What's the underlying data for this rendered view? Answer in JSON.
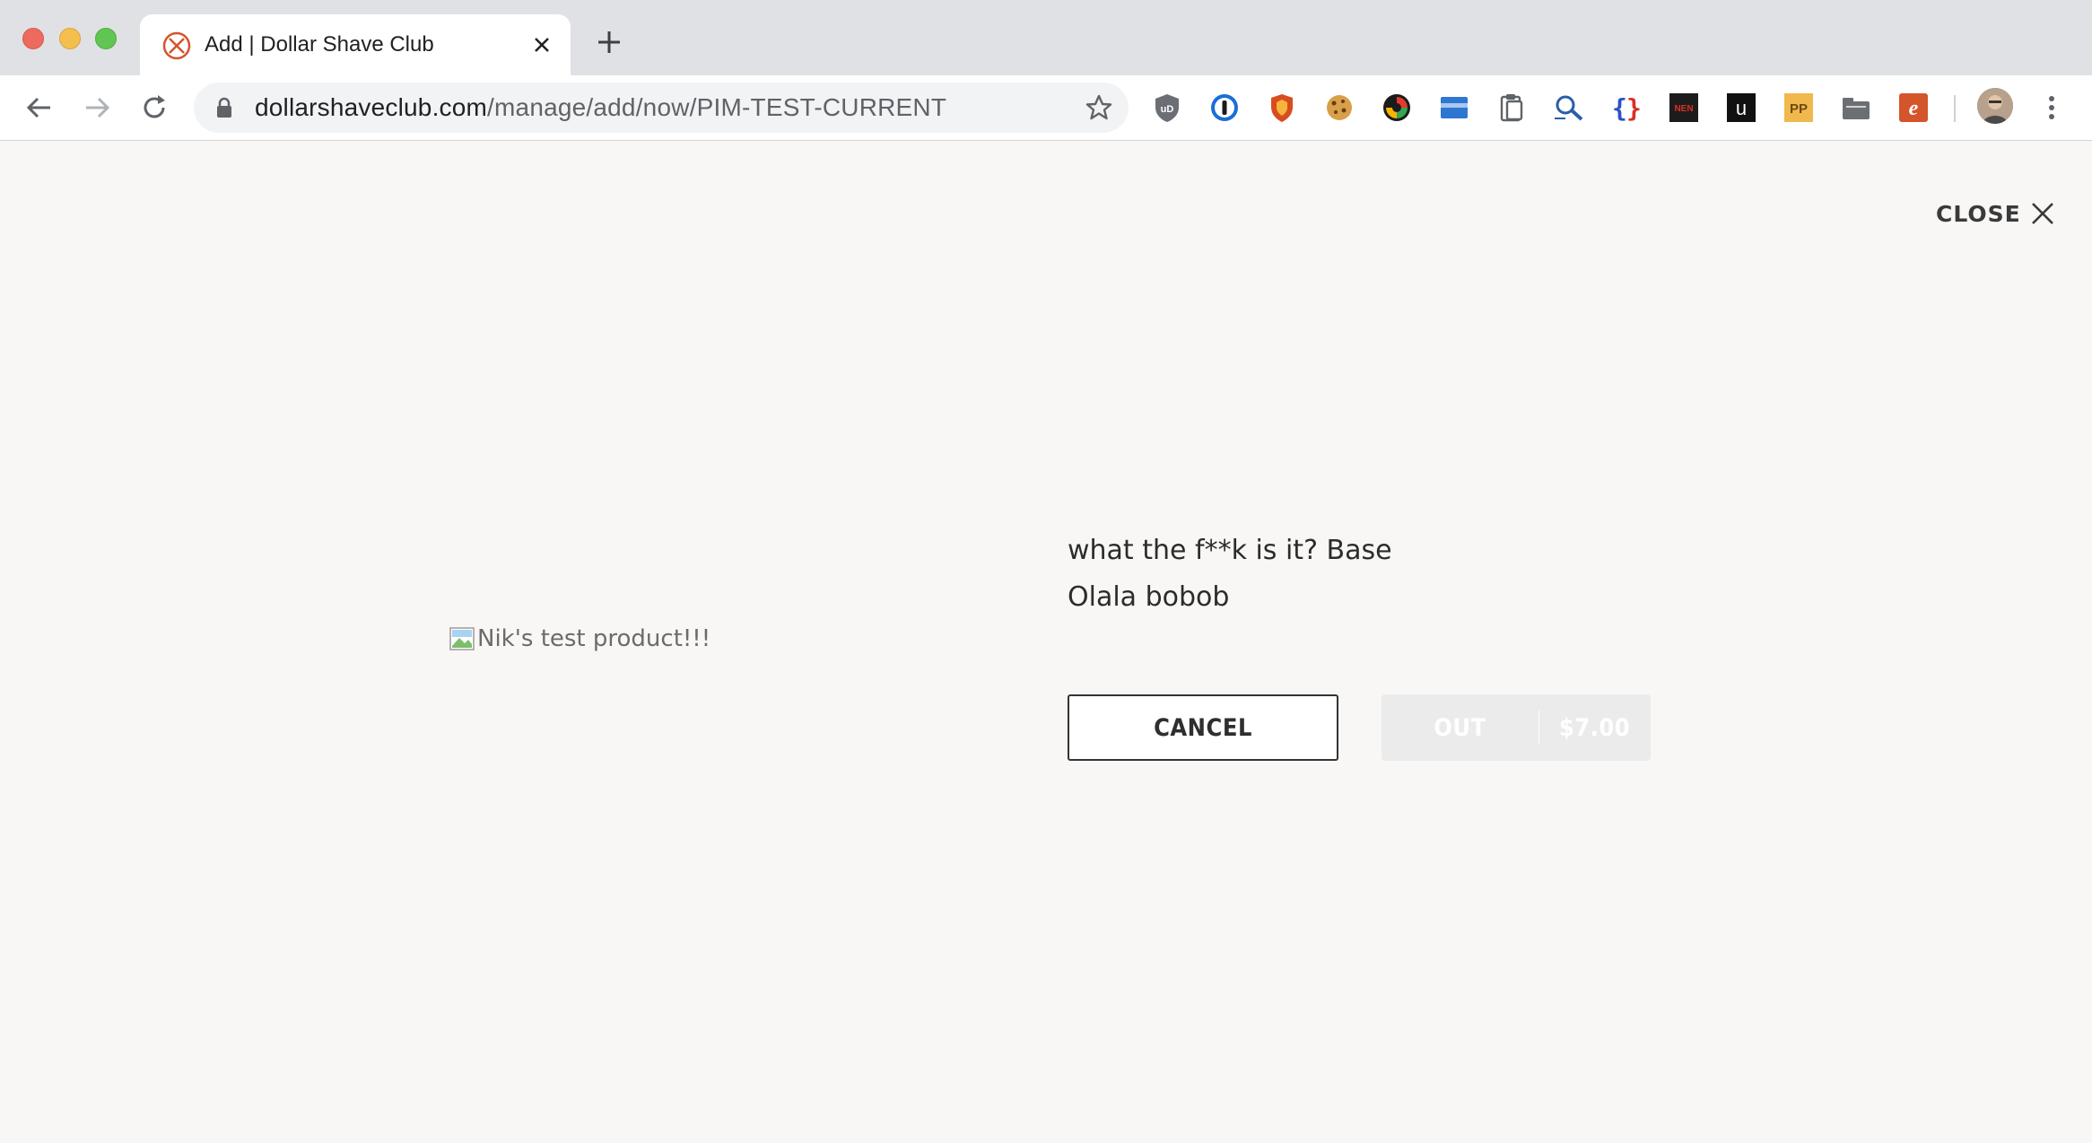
{
  "browser": {
    "tab_title": "Add | Dollar Shave Club",
    "url_host": "dollarshaveclub.com",
    "url_path": "/manage/add/now/PIM-TEST-CURRENT",
    "extensions": [
      "ublock-icon",
      "onepassword-icon",
      "shield-extension-icon",
      "cookie-icon",
      "color-wheel-icon",
      "card-icon",
      "clipboard-icon",
      "search-magnifier-icon",
      "json-braces-icon",
      "nen-icon",
      "u-icon",
      "pp-icon",
      "folder-icon",
      "e-icon"
    ],
    "ext_labels": {
      "nen": "NEN",
      "u": "U",
      "pp": "PP",
      "e": "e",
      "braces": "{ }"
    },
    "accent": "#d4542b"
  },
  "page": {
    "close_label": "CLOSE",
    "product_image_alt": "Nik's test product!!!",
    "product_name_line1": "what the f**k is it? Base",
    "product_name_line2": "Olala bobob",
    "cancel_label": "CANCEL",
    "out_label": "OUT",
    "price": "$7.00"
  }
}
